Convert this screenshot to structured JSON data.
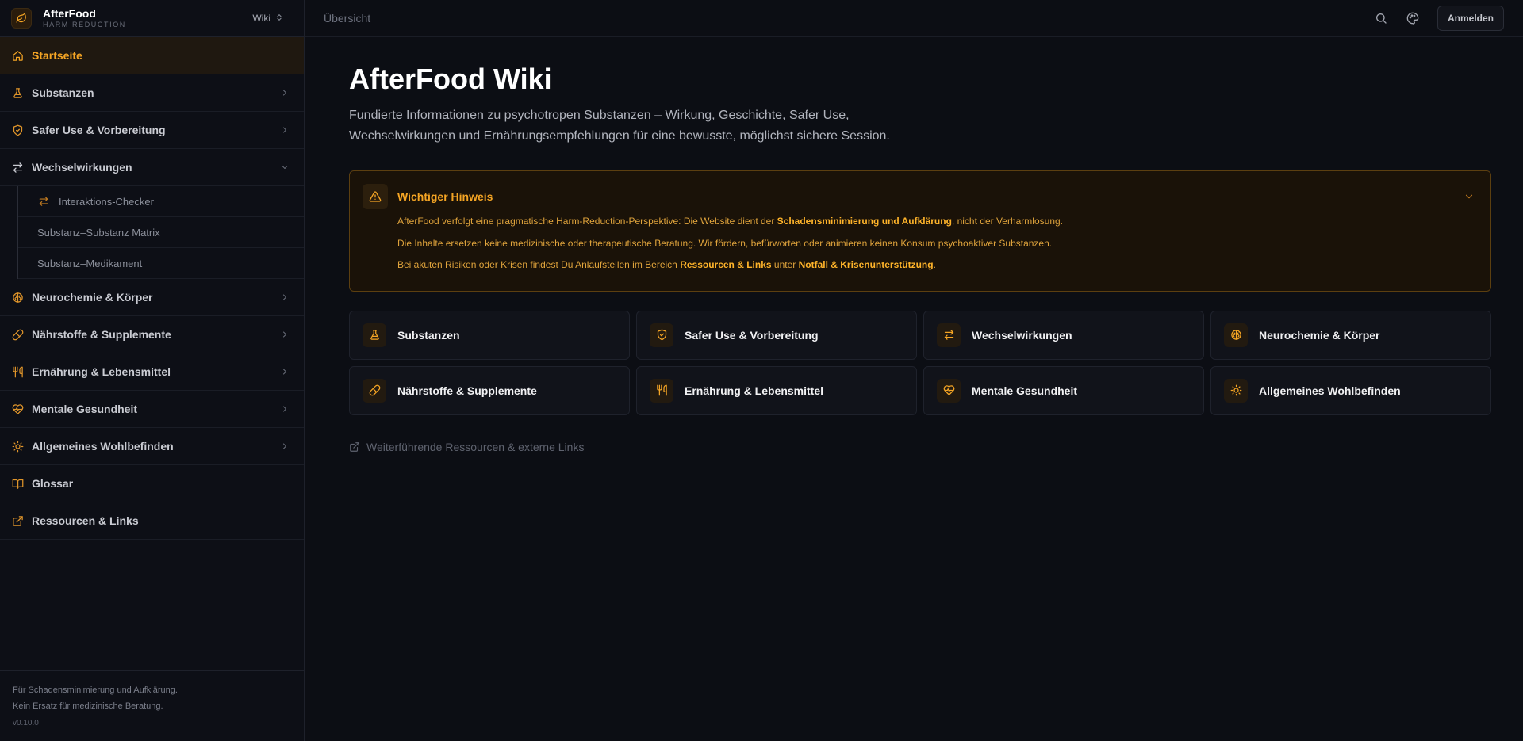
{
  "brand": {
    "name": "AfterFood",
    "subtitle": "HARM REDUCTION",
    "switcher_label": "Wiki"
  },
  "sidebar": {
    "items": [
      {
        "label": "Startseite",
        "icon": "home-icon",
        "active": true
      },
      {
        "label": "Substanzen",
        "icon": "flask-icon"
      },
      {
        "label": "Safer Use & Vorbereitung",
        "icon": "shield-icon"
      },
      {
        "label": "Wechselwirkungen",
        "icon": "arrows-swap-icon",
        "expanded": true
      },
      {
        "label": "Neurochemie & Körper",
        "icon": "brain-icon"
      },
      {
        "label": "Nährstoffe & Supplemente",
        "icon": "pill-icon"
      },
      {
        "label": "Ernährung & Lebensmittel",
        "icon": "utensils-icon"
      },
      {
        "label": "Mentale Gesundheit",
        "icon": "heart-pulse-icon"
      },
      {
        "label": "Allgemeines Wohlbefinden",
        "icon": "sun-icon"
      },
      {
        "label": "Glossar",
        "icon": "book-icon"
      },
      {
        "label": "Ressourcen & Links",
        "icon": "external-link-icon"
      }
    ],
    "sub_items": [
      {
        "label": "Interaktions-Checker",
        "icon": "arrows-swap-icon"
      },
      {
        "label": "Substanz–Substanz Matrix"
      },
      {
        "label": "Substanz–Medikament"
      }
    ],
    "footer": {
      "line1": "Für Schadensminimierung und Aufklärung.",
      "line2": "Kein Ersatz für medizinische Beratung.",
      "version": "v0.10.0"
    }
  },
  "topbar": {
    "breadcrumb": "Übersicht",
    "login_label": "Anmelden"
  },
  "page": {
    "title": "AfterFood Wiki",
    "lead": "Fundierte Informationen zu psychotropen Substanzen – Wirkung, Geschichte, Safer Use, Wechselwirkungen und Ernährungsempfehlungen für eine bewusste, möglichst sichere Session."
  },
  "notice": {
    "title": "Wichtiger Hinweis",
    "p1_pre": "AfterFood verfolgt eine pragmatische Harm-Reduction-Perspektive: Die Website dient der ",
    "p1_bold": "Schadensminimierung und Aufklärung",
    "p1_post": ", nicht der Verharmlosung.",
    "p2": "Die Inhalte ersetzen keine medizinische oder therapeutische Beratung. Wir fördern, befürworten oder animieren keinen Konsum psychoaktiver Substanzen.",
    "p3_pre": "Bei akuten Risiken oder Krisen findest Du Anlaufstellen im Bereich ",
    "p3_link": "Ressourcen & Links",
    "p3_mid": " unter ",
    "p3_bold": "Notfall & Krisenunterstützung",
    "p3_post": "."
  },
  "cards": [
    {
      "label": "Substanzen",
      "icon": "flask-icon"
    },
    {
      "label": "Safer Use & Vorbereitung",
      "icon": "shield-icon"
    },
    {
      "label": "Wechselwirkungen",
      "icon": "arrows-swap-icon"
    },
    {
      "label": "Neurochemie & Körper",
      "icon": "brain-icon"
    },
    {
      "label": "Nährstoffe & Supplemente",
      "icon": "pill-icon"
    },
    {
      "label": "Ernährung & Lebensmittel",
      "icon": "utensils-icon"
    },
    {
      "label": "Mentale Gesundheit",
      "icon": "heart-pulse-icon"
    },
    {
      "label": "Allgemeines Wohlbefinden",
      "icon": "sun-icon"
    }
  ],
  "external_link": "Weiterführende Ressourcen & externe Links",
  "colors": {
    "accent": "#f5a524",
    "background": "#0c0e14",
    "sidebar": "#0d0f16"
  }
}
